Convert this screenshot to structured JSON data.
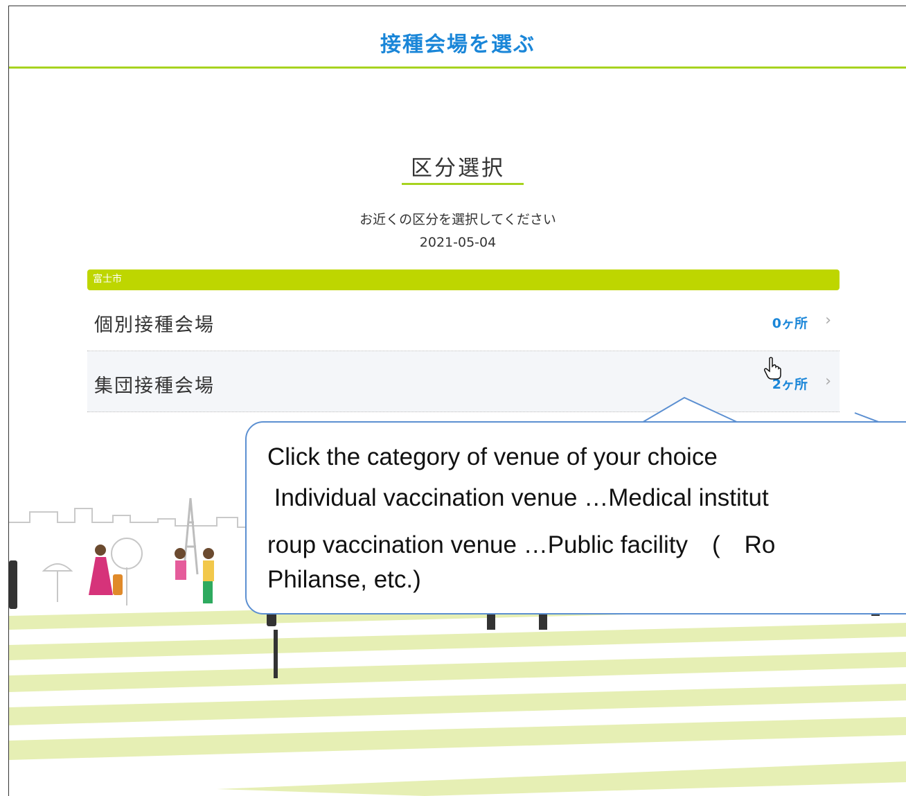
{
  "header": {
    "title": "接種会場を選ぶ"
  },
  "section": {
    "title": "区分選択",
    "instruction": "お近くの区分を選択してください",
    "date": "2021-05-04"
  },
  "city": {
    "name": "富士市"
  },
  "rows": [
    {
      "label": "個別接種会場",
      "count": "0ヶ所"
    },
    {
      "label": "集団接種会場",
      "count": "2ヶ所"
    }
  ],
  "callout": {
    "line1": "Click the category of venue of your choice",
    "line2": " Individual vaccination venue …Medical institut",
    "line3": "roup vaccination venue …Public facility　(　Ro",
    "line4": "Philanse, etc.)"
  },
  "colors": {
    "accent_green": "#a7d31f",
    "bar_green": "#bed600",
    "link_blue": "#1a86d8",
    "callout_border": "#5b8fd1"
  },
  "icons": {
    "chevron": "chevron-right-icon",
    "cursor": "hand-pointer-icon"
  }
}
